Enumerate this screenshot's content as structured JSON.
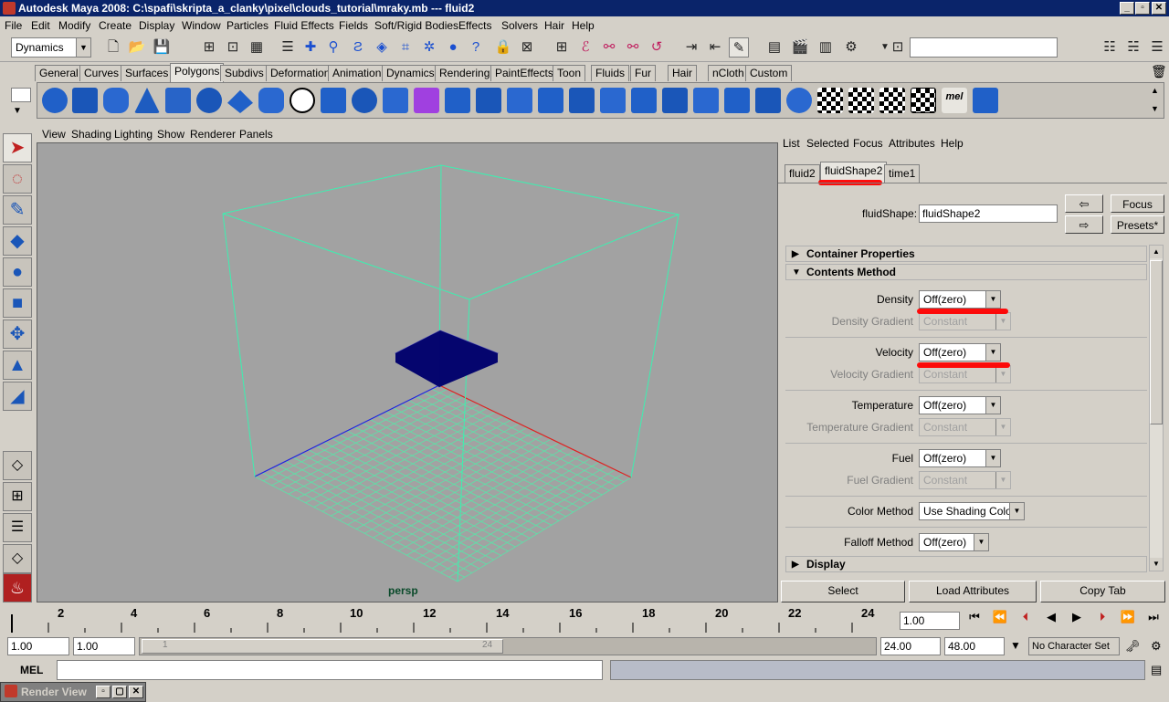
{
  "window": {
    "title": "Autodesk Maya 2008: C:\\spafi\\skripta_a_clanky\\pixel\\clouds_tutorial\\mraky.mb   ---   fluid2"
  },
  "menubar": [
    "File",
    "Edit",
    "Modify",
    "Create",
    "Display",
    "Window",
    "Particles",
    "Fluid Effects",
    "Fields",
    "Soft/Rigid Bodies",
    "Effects",
    "Solvers",
    "Hair",
    "Help"
  ],
  "toolbar": {
    "menuset": "Dynamics"
  },
  "shelf_tabs": [
    "General",
    "Curves",
    "Surfaces",
    "Polygons",
    "Subdivs",
    "Deformation",
    "Animation",
    "Dynamics",
    "Rendering",
    "PaintEffects",
    "Toon",
    "Fluids",
    "Fur",
    "Hair",
    "nCloth",
    "Custom"
  ],
  "shelf_active": "Polygons",
  "shelf_mel_label": "mel",
  "viewport": {
    "menu": [
      "View",
      "Shading",
      "Lighting",
      "Show",
      "Renderer",
      "Panels"
    ],
    "camera_label": "persp"
  },
  "attribute_editor": {
    "menu": [
      "List",
      "Selected",
      "Focus",
      "Attributes",
      "Help"
    ],
    "tabs": [
      "fluid2",
      "fluidShape2",
      "time1"
    ],
    "active_tab": "fluidShape2",
    "node_label": "fluidShape:",
    "node_value": "fluidShape2",
    "focus_button": "Focus",
    "presets_button": "Presets*",
    "sections": {
      "container": "Container Properties",
      "contents": "Contents Method",
      "display": "Display"
    },
    "attrs": [
      {
        "label": "Density",
        "value": "Off(zero)"
      },
      {
        "label": "Density Gradient",
        "value": "Constant"
      },
      {
        "label": "Velocity",
        "value": "Off(zero)"
      },
      {
        "label": "Velocity Gradient",
        "value": "Constant"
      },
      {
        "label": "Temperature",
        "value": "Off(zero)"
      },
      {
        "label": "Temperature Gradient",
        "value": "Constant"
      },
      {
        "label": "Fuel",
        "value": "Off(zero)"
      },
      {
        "label": "Fuel Gradient",
        "value": "Constant"
      },
      {
        "label": "Color Method",
        "value": "Use Shading Color"
      },
      {
        "label": "Falloff Method",
        "value": "Off(zero)"
      }
    ],
    "buttons": {
      "select": "Select",
      "load": "Load Attributes",
      "copy": "Copy Tab"
    }
  },
  "timeline": {
    "ticks": [
      "2",
      "4",
      "6",
      "8",
      "10",
      "12",
      "14",
      "16",
      "18",
      "20",
      "22",
      "24"
    ],
    "current_time": "1.00"
  },
  "range": {
    "start": "1.00",
    "play_start": "1.00",
    "slider_start": "1",
    "slider_end": "24",
    "play_end": "24.00",
    "end": "48.00",
    "character_set": "No Character Set"
  },
  "mel": {
    "label": "MEL"
  },
  "taskbar": {
    "label": "Render View"
  },
  "colors": {
    "title_bg": "#0a246a",
    "viewport_bg": "#a2a2a2",
    "grid": "#5ce2a8",
    "wire": "#3cf0b0",
    "fluid_box": "#05056e",
    "x_axis": "#e02020",
    "z_axis": "#2020e0",
    "red_marker": "#ff0000"
  }
}
